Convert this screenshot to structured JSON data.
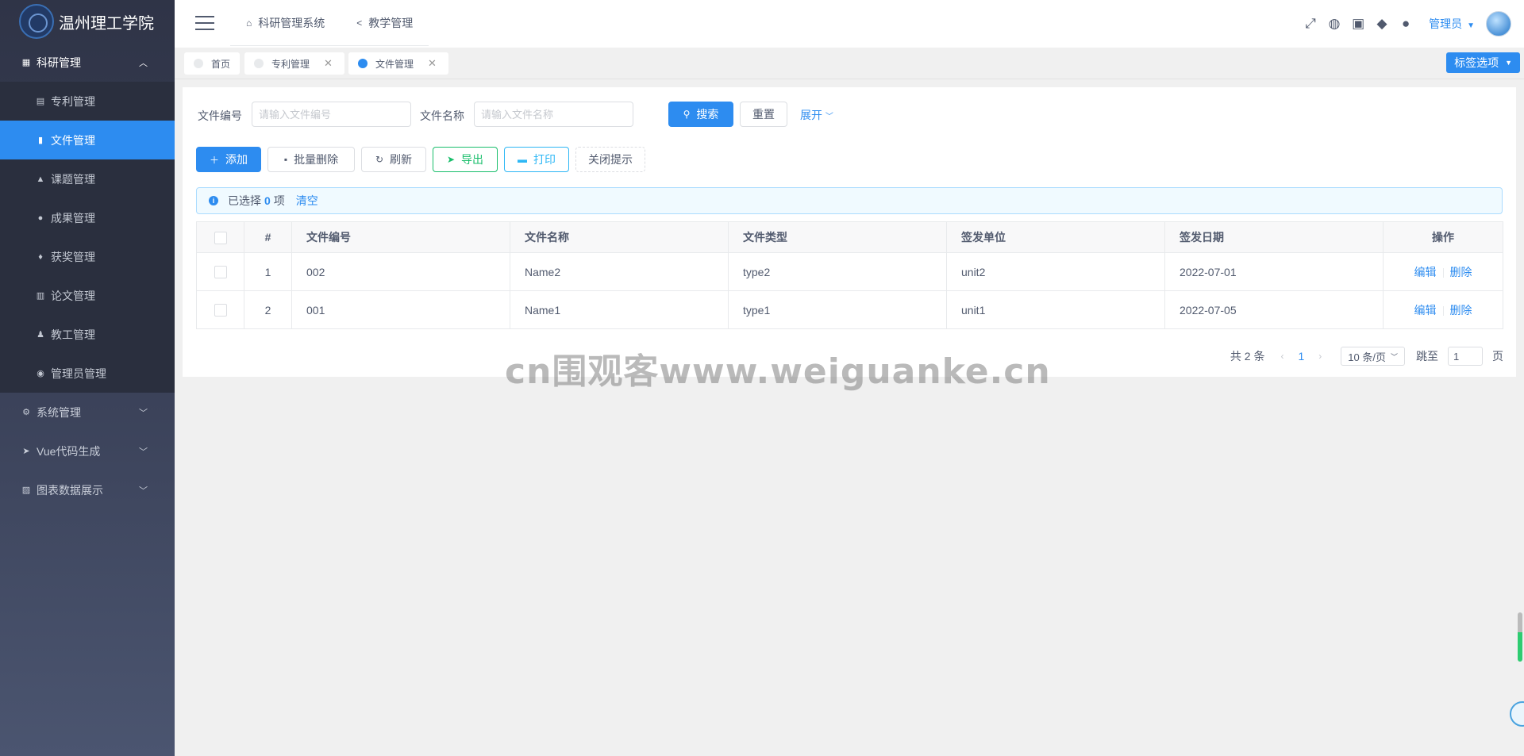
{
  "brand": {
    "title": "温州理工学院"
  },
  "sidebar": {
    "items": [
      {
        "label": "科研管理",
        "icon": "grid-icon",
        "glyph": "▦",
        "expanded": true
      },
      {
        "label": "系统管理",
        "icon": "gear-icon",
        "glyph": "⚙"
      },
      {
        "label": "Vue代码生成",
        "icon": "send-icon",
        "glyph": "➤"
      },
      {
        "label": "图表数据展示",
        "icon": "chart-icon",
        "glyph": "▨"
      }
    ],
    "submenu": [
      {
        "label": "专利管理",
        "icon": "book-icon",
        "glyph": "▤"
      },
      {
        "label": "文件管理",
        "icon": "file-icon",
        "glyph": "▮",
        "active": true
      },
      {
        "label": "课题管理",
        "icon": "flask-icon",
        "glyph": "▲"
      },
      {
        "label": "成果管理",
        "icon": "circle-icon",
        "glyph": "●"
      },
      {
        "label": "获奖管理",
        "icon": "trophy-icon",
        "glyph": "♦"
      },
      {
        "label": "论文管理",
        "icon": "paper-icon",
        "glyph": "▥"
      },
      {
        "label": "教工管理",
        "icon": "people-icon",
        "glyph": "♟"
      },
      {
        "label": "管理员管理",
        "icon": "user-circle-icon",
        "glyph": "◉"
      }
    ]
  },
  "header": {
    "nav": [
      {
        "label": "科研管理系统",
        "icon": "home-icon",
        "glyph": "⌂"
      },
      {
        "label": "教学管理",
        "icon": "share-icon",
        "glyph": "<"
      }
    ],
    "icons": [
      {
        "name": "fullscreen-icon",
        "glyph": "⤢"
      },
      {
        "name": "globe-icon",
        "glyph": "◍"
      },
      {
        "name": "lock-icon",
        "glyph": "▣"
      },
      {
        "name": "bell-icon",
        "glyph": "◆"
      },
      {
        "name": "github-icon",
        "glyph": "●"
      }
    ],
    "user": "管理员"
  },
  "tabs": [
    {
      "label": "首页",
      "closable": false
    },
    {
      "label": "专利管理",
      "closable": true
    },
    {
      "label": "文件管理",
      "closable": true,
      "active": true
    }
  ],
  "tab_options": "标签选项",
  "search": {
    "file_no_label": "文件编号",
    "file_no_placeholder": "请输入文件编号",
    "file_name_label": "文件名称",
    "file_name_placeholder": "请输入文件名称",
    "search_btn": "搜索",
    "reset_btn": "重置",
    "expand": "展开"
  },
  "toolbar": {
    "add": "添加",
    "batch_delete": "批量删除",
    "refresh": "刷新",
    "export": "导出",
    "print": "打印",
    "close_tip": "关闭提示"
  },
  "alert": {
    "prefix": "已选择",
    "count": "0",
    "suffix": "项",
    "clear": "清空"
  },
  "table": {
    "columns": [
      "#",
      "文件编号",
      "文件名称",
      "文件类型",
      "签发单位",
      "签发日期",
      "操作"
    ],
    "rows": [
      {
        "index": "1",
        "file_no": "002",
        "name": "Name2",
        "type": "type2",
        "unit": "unit2",
        "date": "2022-07-01"
      },
      {
        "index": "2",
        "file_no": "001",
        "name": "Name1",
        "type": "type1",
        "unit": "unit1",
        "date": "2022-07-05"
      }
    ],
    "edit": "编辑",
    "delete": "删除"
  },
  "pager": {
    "total": "共 2 条",
    "current": "1",
    "page_size": "10 条/页",
    "jump_label": "跳至",
    "jump_value": "1",
    "page_suffix": "页"
  },
  "watermark": "cn围观客www.weiguanke.cn",
  "colors": {
    "primary": "#2d8cf0",
    "success": "#19be6b",
    "info": "#2db7f5",
    "sidebar": "#2f3447"
  }
}
